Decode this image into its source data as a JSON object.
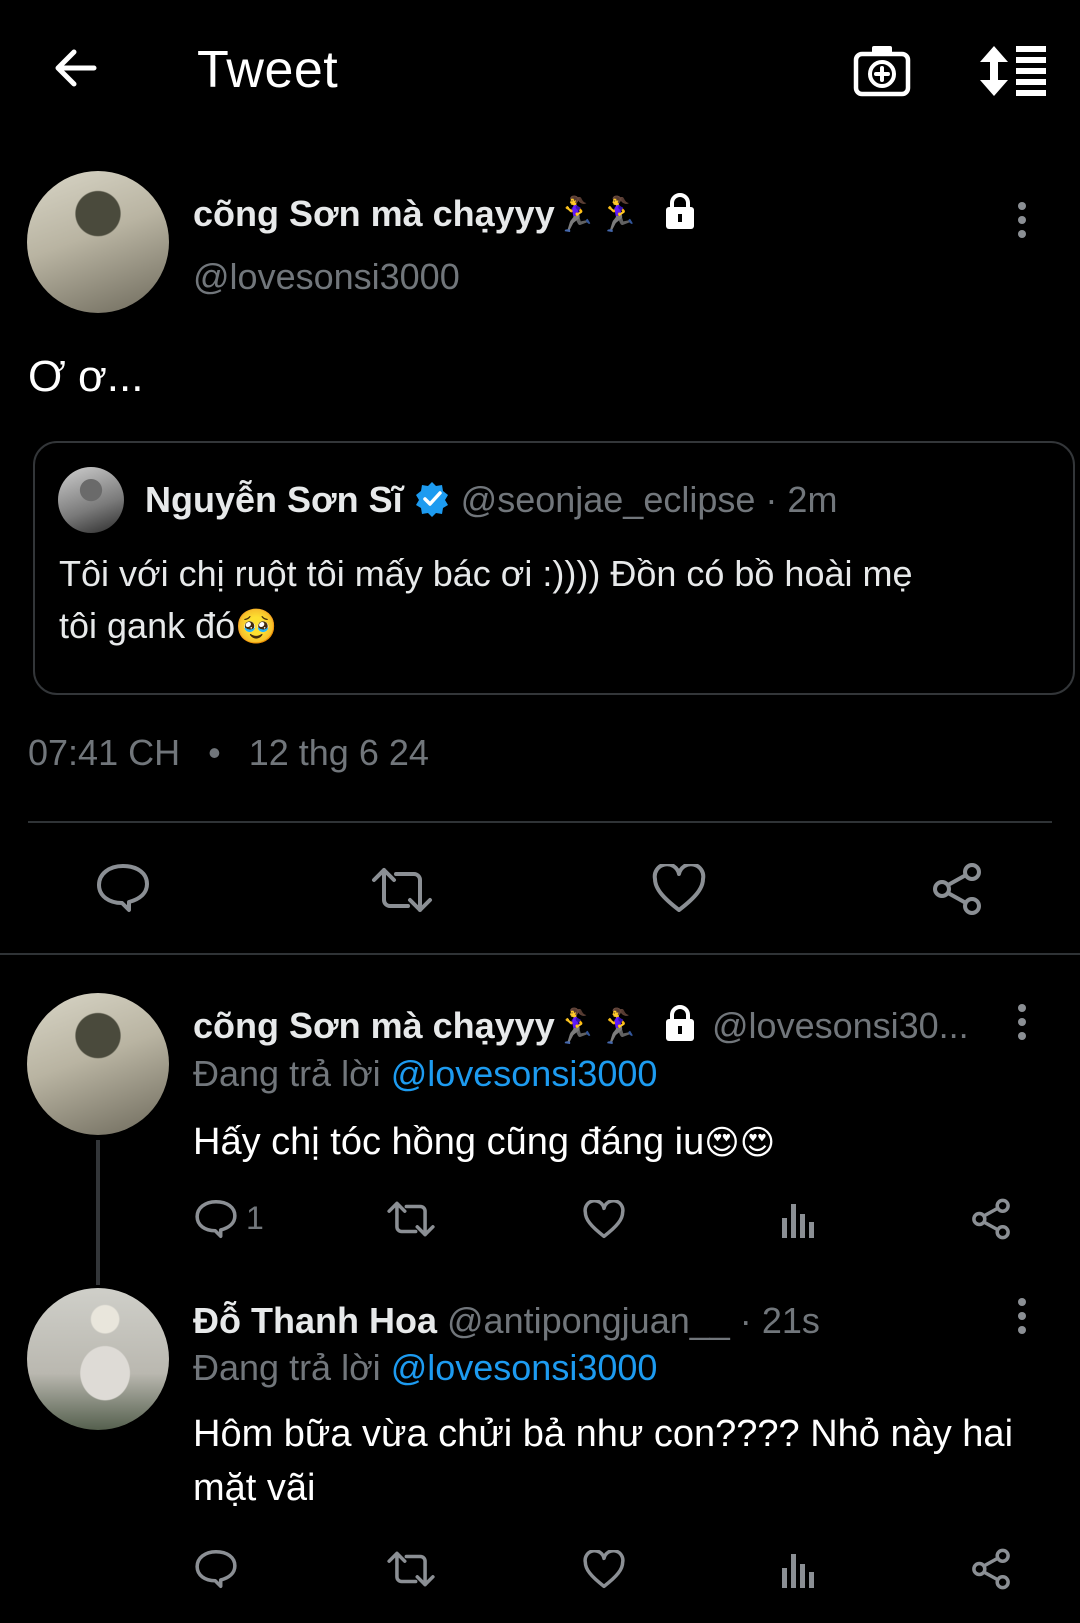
{
  "header": {
    "title": "Tweet",
    "back_icon": "back-arrow-icon",
    "camera_icon": "camera-add-icon",
    "sort_icon": "sort-list-icon"
  },
  "main_tweet": {
    "display_name": "cõng Sơn mà chạyyy",
    "name_emoji": "🏃‍♀️🏃‍♀️",
    "handle": "@lovesonsi3000",
    "text": "Ơ ơ...",
    "quote": {
      "display_name": "Nguyễn Sơn Sĩ",
      "handle": "@seonjae_eclipse",
      "separator": "·",
      "time": "2m",
      "text_line1": "Tôi với chị ruột tôi mấy bác ơi :)))) Đồn có bồ hoài mẹ",
      "text_line2": "tôi gank đó",
      "text_emoji": "🥹"
    },
    "timestamp": "07:41 CH",
    "dot": "•",
    "date": "12 thg 6 24"
  },
  "replies": [
    {
      "display_name": "cõng Sơn mà chạyyy",
      "name_emoji": "🏃‍♀️🏃‍♀️",
      "handle": "@lovesonsi30...",
      "replying_prefix": "Đang trả lời",
      "replying_to": "@lovesonsi3000",
      "text": "Hấy chị tóc hồng cũng đáng iu",
      "text_emoji": "😍😍",
      "reply_count": "1"
    },
    {
      "display_name": "Đỗ Thanh Hoa",
      "handle": "@antipongjuan__",
      "separator": "·",
      "time": "21s",
      "replying_prefix": "Đang trả lời",
      "replying_to": "@lovesonsi3000",
      "text_line1": "Hôm bữa vừa chửi bả như con???? Nhỏ này hai",
      "text_line2": "mặt vãi"
    }
  ],
  "colors": {
    "background": "#000000",
    "text": "#e7e9ea",
    "muted": "#71767b",
    "link": "#1d9bf0",
    "border": "#2f3336"
  }
}
